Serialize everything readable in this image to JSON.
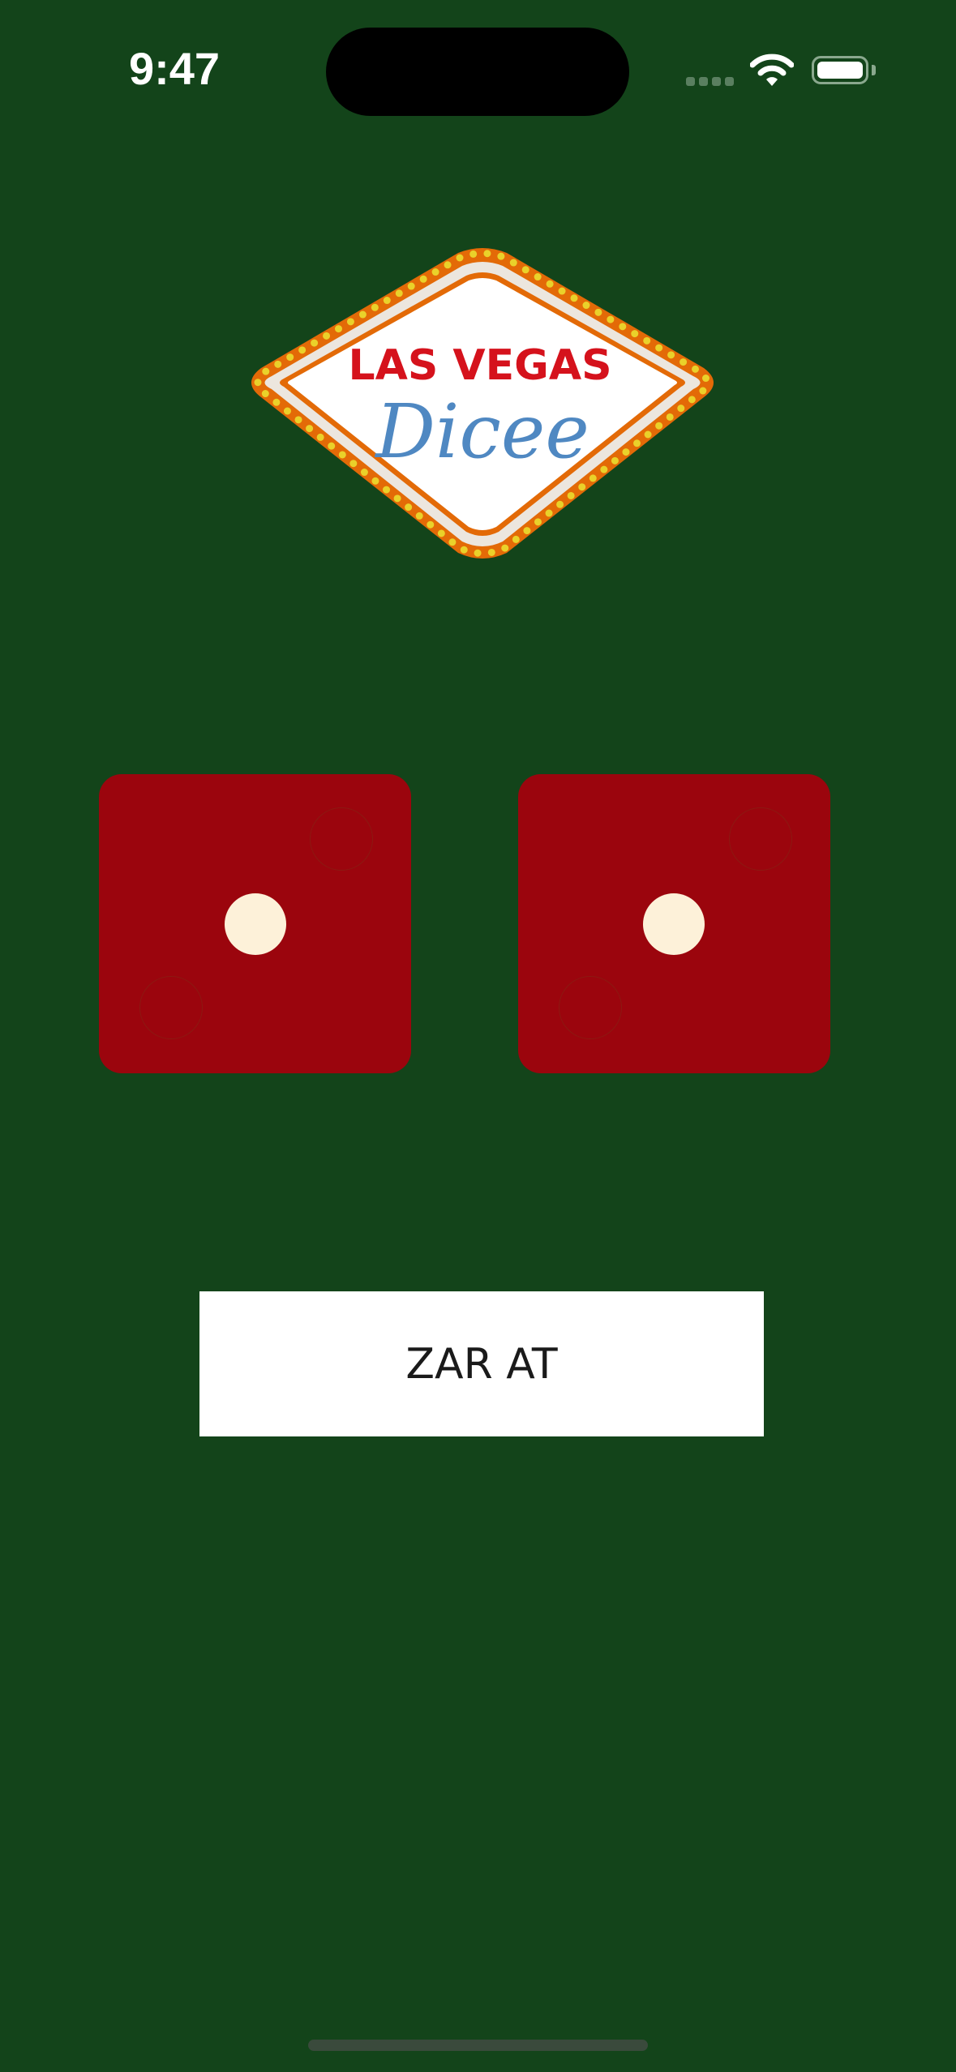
{
  "status_bar": {
    "time": "9:47",
    "icons": [
      "cellular-signal-icon",
      "wifi-icon",
      "battery-icon"
    ]
  },
  "logo": {
    "line1": "LAS VEGAS",
    "line2": "Dicee"
  },
  "dice": [
    {
      "value": 1,
      "color": "#9b050d",
      "pip_color": "#fdf1d9"
    },
    {
      "value": 1,
      "color": "#9b050d",
      "pip_color": "#fdf1d9"
    }
  ],
  "roll_button": {
    "label": "ZAR AT"
  },
  "colors": {
    "background": "#13441a",
    "sign_border": "#e36a07",
    "sign_bulbs": "#ead12a",
    "las_vegas_red": "#d5121c",
    "dicee_blue": "#4f88c2"
  }
}
